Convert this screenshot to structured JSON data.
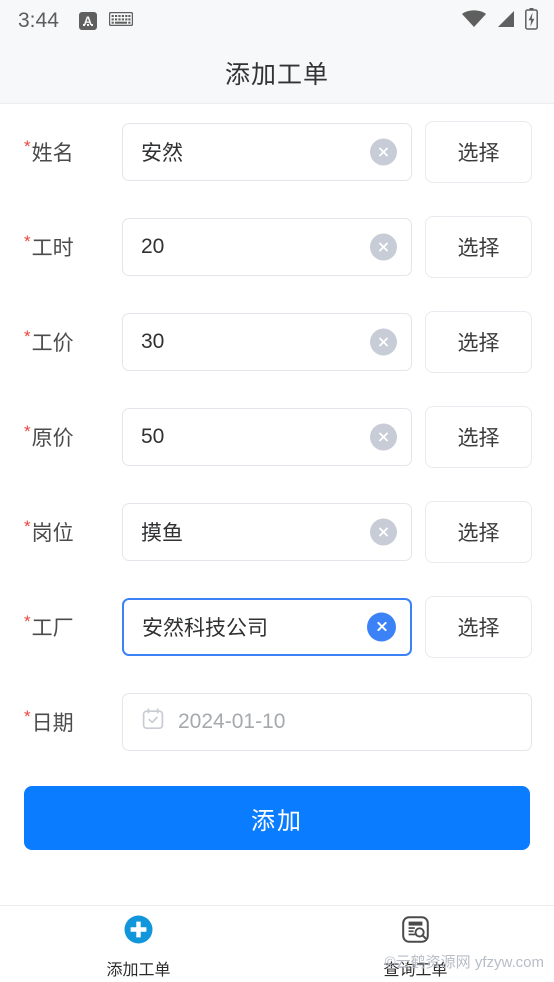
{
  "statusbar": {
    "time": "3:44",
    "ime_badge": "A",
    "icons": [
      "keyboard-icon",
      "wifi-icon",
      "cellular-signal-icon",
      "battery-charging-icon"
    ]
  },
  "header": {
    "title": "添加工单"
  },
  "form": {
    "required_marker": "*",
    "select_label": "选择",
    "rows": [
      {
        "label": "姓名",
        "value": "安然",
        "focused": false,
        "has_clear": true,
        "has_select": true
      },
      {
        "label": "工时",
        "value": "20",
        "focused": false,
        "has_clear": true,
        "has_select": true
      },
      {
        "label": "工价",
        "value": "30",
        "focused": false,
        "has_clear": true,
        "has_select": true
      },
      {
        "label": "原价",
        "value": "50",
        "focused": false,
        "has_clear": true,
        "has_select": true
      },
      {
        "label": "岗位",
        "value": "摸鱼",
        "focused": false,
        "has_clear": true,
        "has_select": true
      },
      {
        "label": "工厂",
        "value": "安然科技公司",
        "focused": true,
        "has_clear": true,
        "has_select": true
      }
    ],
    "date_row": {
      "label": "日期",
      "value": "2024-01-10",
      "icon": "calendar-icon"
    }
  },
  "submit": {
    "label": "添加"
  },
  "tabbar": {
    "items": [
      {
        "label": "添加工单",
        "icon": "add-circle-icon",
        "active": true
      },
      {
        "label": "查询工单",
        "icon": "document-search-icon",
        "active": false
      }
    ]
  },
  "watermark": {
    "text": "©云鹤资源网 yfzyw.com"
  },
  "colors": {
    "primary_button": "#0a7cff",
    "focus_border": "#3b82f6",
    "active_tab_icon": "#1296db",
    "required_star": "#e8453c",
    "header_bg": "#f7f8f9"
  }
}
